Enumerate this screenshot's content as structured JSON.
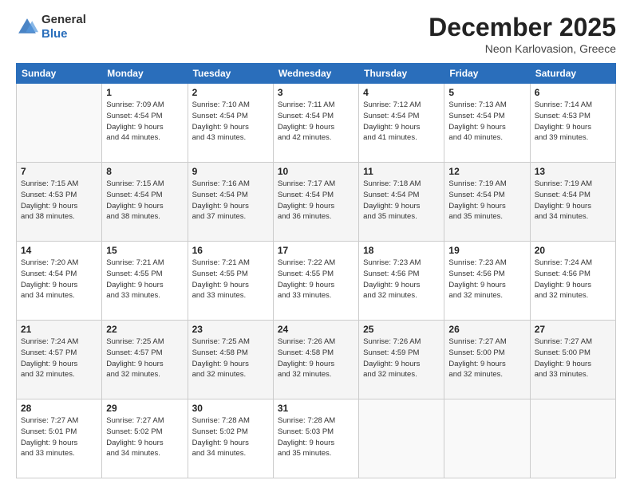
{
  "header": {
    "logo_general": "General",
    "logo_blue": "Blue",
    "title": "December 2025",
    "location": "Neon Karlovasion, Greece"
  },
  "days_of_week": [
    "Sunday",
    "Monday",
    "Tuesday",
    "Wednesday",
    "Thursday",
    "Friday",
    "Saturday"
  ],
  "weeks": [
    [
      {
        "day": "",
        "info": ""
      },
      {
        "day": "1",
        "info": "Sunrise: 7:09 AM\nSunset: 4:54 PM\nDaylight: 9 hours\nand 44 minutes."
      },
      {
        "day": "2",
        "info": "Sunrise: 7:10 AM\nSunset: 4:54 PM\nDaylight: 9 hours\nand 43 minutes."
      },
      {
        "day": "3",
        "info": "Sunrise: 7:11 AM\nSunset: 4:54 PM\nDaylight: 9 hours\nand 42 minutes."
      },
      {
        "day": "4",
        "info": "Sunrise: 7:12 AM\nSunset: 4:54 PM\nDaylight: 9 hours\nand 41 minutes."
      },
      {
        "day": "5",
        "info": "Sunrise: 7:13 AM\nSunset: 4:54 PM\nDaylight: 9 hours\nand 40 minutes."
      },
      {
        "day": "6",
        "info": "Sunrise: 7:14 AM\nSunset: 4:53 PM\nDaylight: 9 hours\nand 39 minutes."
      }
    ],
    [
      {
        "day": "7",
        "info": "Sunrise: 7:15 AM\nSunset: 4:53 PM\nDaylight: 9 hours\nand 38 minutes."
      },
      {
        "day": "8",
        "info": "Sunrise: 7:15 AM\nSunset: 4:54 PM\nDaylight: 9 hours\nand 38 minutes."
      },
      {
        "day": "9",
        "info": "Sunrise: 7:16 AM\nSunset: 4:54 PM\nDaylight: 9 hours\nand 37 minutes."
      },
      {
        "day": "10",
        "info": "Sunrise: 7:17 AM\nSunset: 4:54 PM\nDaylight: 9 hours\nand 36 minutes."
      },
      {
        "day": "11",
        "info": "Sunrise: 7:18 AM\nSunset: 4:54 PM\nDaylight: 9 hours\nand 35 minutes."
      },
      {
        "day": "12",
        "info": "Sunrise: 7:19 AM\nSunset: 4:54 PM\nDaylight: 9 hours\nand 35 minutes."
      },
      {
        "day": "13",
        "info": "Sunrise: 7:19 AM\nSunset: 4:54 PM\nDaylight: 9 hours\nand 34 minutes."
      }
    ],
    [
      {
        "day": "14",
        "info": "Sunrise: 7:20 AM\nSunset: 4:54 PM\nDaylight: 9 hours\nand 34 minutes."
      },
      {
        "day": "15",
        "info": "Sunrise: 7:21 AM\nSunset: 4:55 PM\nDaylight: 9 hours\nand 33 minutes."
      },
      {
        "day": "16",
        "info": "Sunrise: 7:21 AM\nSunset: 4:55 PM\nDaylight: 9 hours\nand 33 minutes."
      },
      {
        "day": "17",
        "info": "Sunrise: 7:22 AM\nSunset: 4:55 PM\nDaylight: 9 hours\nand 33 minutes."
      },
      {
        "day": "18",
        "info": "Sunrise: 7:23 AM\nSunset: 4:56 PM\nDaylight: 9 hours\nand 32 minutes."
      },
      {
        "day": "19",
        "info": "Sunrise: 7:23 AM\nSunset: 4:56 PM\nDaylight: 9 hours\nand 32 minutes."
      },
      {
        "day": "20",
        "info": "Sunrise: 7:24 AM\nSunset: 4:56 PM\nDaylight: 9 hours\nand 32 minutes."
      }
    ],
    [
      {
        "day": "21",
        "info": "Sunrise: 7:24 AM\nSunset: 4:57 PM\nDaylight: 9 hours\nand 32 minutes."
      },
      {
        "day": "22",
        "info": "Sunrise: 7:25 AM\nSunset: 4:57 PM\nDaylight: 9 hours\nand 32 minutes."
      },
      {
        "day": "23",
        "info": "Sunrise: 7:25 AM\nSunset: 4:58 PM\nDaylight: 9 hours\nand 32 minutes."
      },
      {
        "day": "24",
        "info": "Sunrise: 7:26 AM\nSunset: 4:58 PM\nDaylight: 9 hours\nand 32 minutes."
      },
      {
        "day": "25",
        "info": "Sunrise: 7:26 AM\nSunset: 4:59 PM\nDaylight: 9 hours\nand 32 minutes."
      },
      {
        "day": "26",
        "info": "Sunrise: 7:27 AM\nSunset: 5:00 PM\nDaylight: 9 hours\nand 32 minutes."
      },
      {
        "day": "27",
        "info": "Sunrise: 7:27 AM\nSunset: 5:00 PM\nDaylight: 9 hours\nand 33 minutes."
      }
    ],
    [
      {
        "day": "28",
        "info": "Sunrise: 7:27 AM\nSunset: 5:01 PM\nDaylight: 9 hours\nand 33 minutes."
      },
      {
        "day": "29",
        "info": "Sunrise: 7:27 AM\nSunset: 5:02 PM\nDaylight: 9 hours\nand 34 minutes."
      },
      {
        "day": "30",
        "info": "Sunrise: 7:28 AM\nSunset: 5:02 PM\nDaylight: 9 hours\nand 34 minutes."
      },
      {
        "day": "31",
        "info": "Sunrise: 7:28 AM\nSunset: 5:03 PM\nDaylight: 9 hours\nand 35 minutes."
      },
      {
        "day": "",
        "info": ""
      },
      {
        "day": "",
        "info": ""
      },
      {
        "day": "",
        "info": ""
      }
    ]
  ]
}
